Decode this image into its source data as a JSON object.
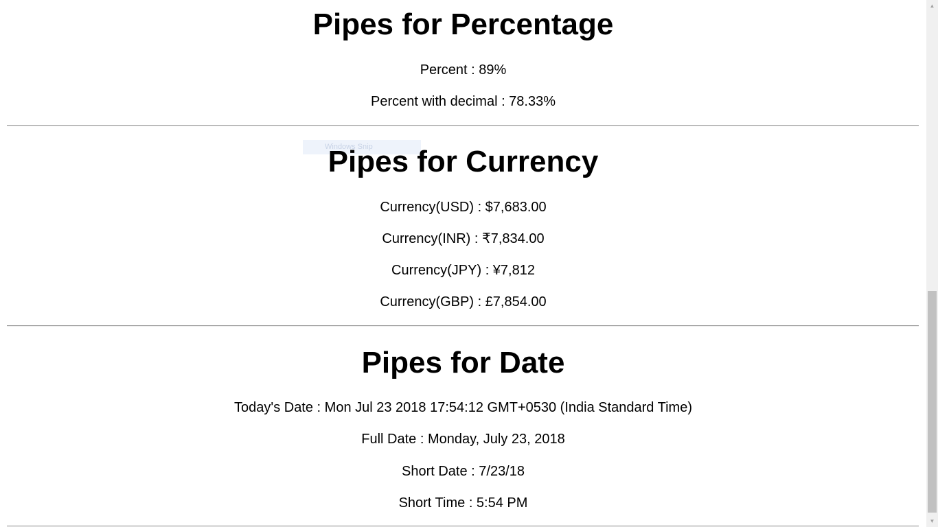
{
  "percentage": {
    "title": "Pipes for Percentage",
    "percent": "Percent : 89%",
    "percent_decimal": "Percent with decimal : 78.33%"
  },
  "overlay": {
    "ghost_text": "Windows Snip"
  },
  "currency": {
    "title": "Pipes for Currency",
    "usd": "Currency(USD) : $7,683.00",
    "inr": "Currency(INR) : ₹7,834.00",
    "jpy": "Currency(JPY) : ¥7,812",
    "gbp": "Currency(GBP) : £7,854.00"
  },
  "date": {
    "title": "Pipes for Date",
    "today": "Today's Date : Mon Jul 23 2018 17:54:12 GMT+0530 (India Standard Time)",
    "full": "Full Date : Monday, July 23, 2018",
    "short": "Short Date : 7/23/18",
    "time": "Short Time : 5:54 PM"
  },
  "scrollbar": {
    "up_icon": "triangle-up-icon",
    "down_icon": "triangle-down-icon",
    "scroll_position_fraction": 0.56
  }
}
